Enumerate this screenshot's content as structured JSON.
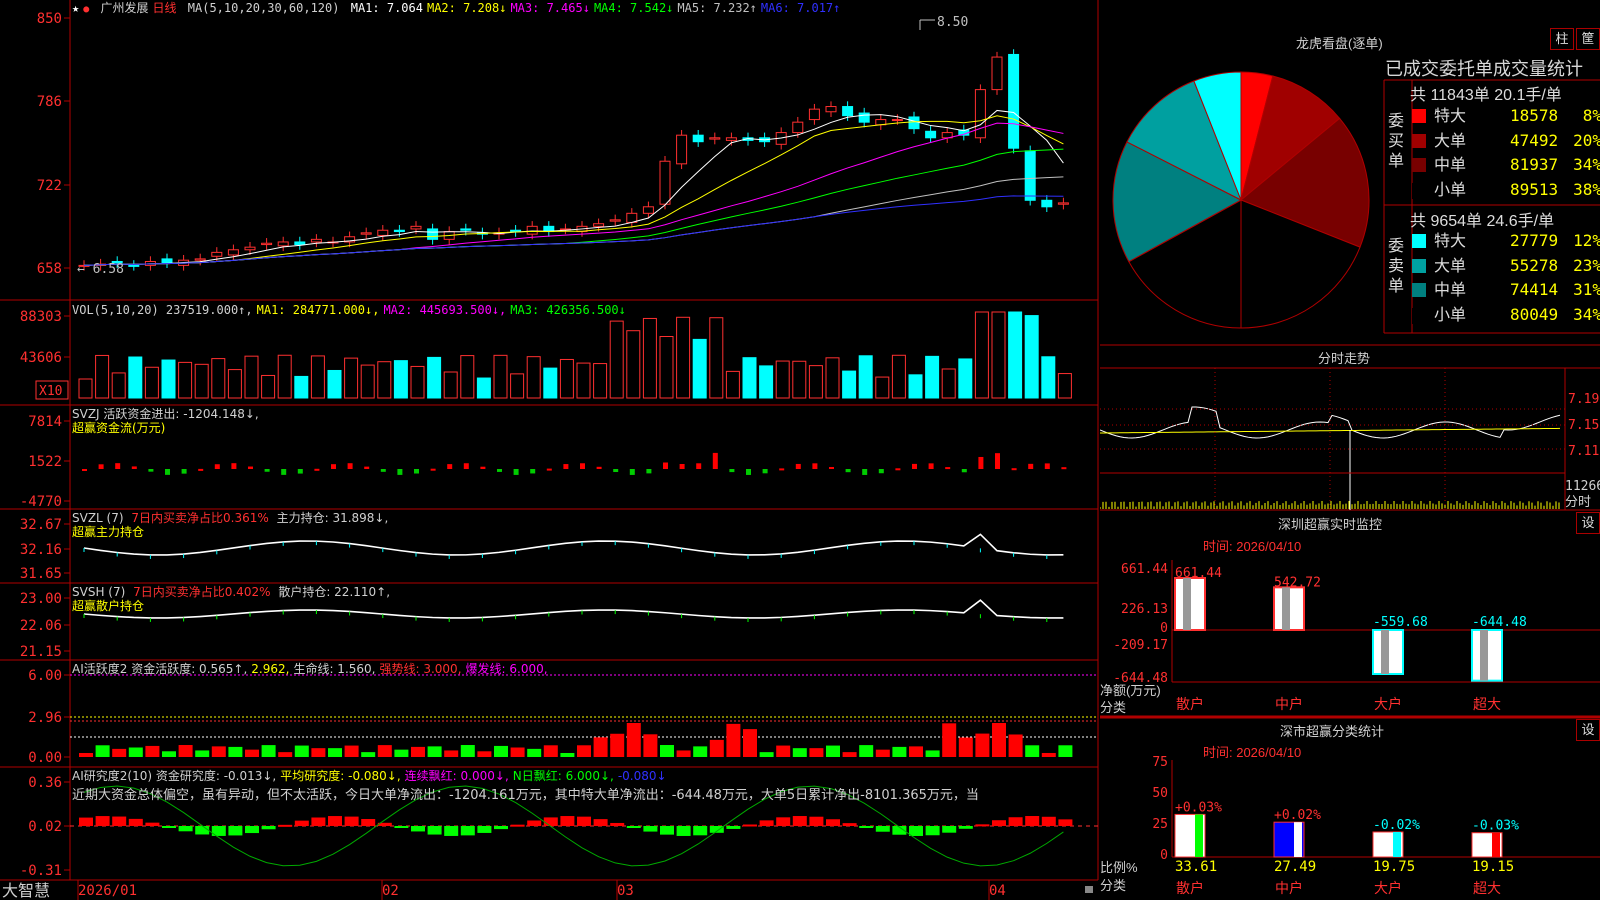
{
  "chart_header": {
    "star": "★",
    "stock_name": "广州发展",
    "period": "日线",
    "ma_label": "MA(5,10,20,30,60,120)",
    "ma": [
      {
        "label": "MA1: 7.064",
        "color": "#ffffff"
      },
      {
        "label": "MA2: 7.208↓",
        "color": "#ffff00"
      },
      {
        "label": "MA3: 7.465↓",
        "color": "#ff00ff"
      },
      {
        "label": "MA4: 7.542↓",
        "color": "#00ff00"
      },
      {
        "label": "MA5: 7.232↑",
        "color": "#c0c0c0"
      },
      {
        "label": "MA6: 7.017↑",
        "color": "#3030ff"
      }
    ],
    "high_label": "8.50",
    "low_label": "6.58"
  },
  "price_axis": [
    "850",
    "786",
    "722",
    "658"
  ],
  "vol_panel": {
    "header": [
      {
        "text": "VOL(5,10,20) 237519.000↑,",
        "color": "#d0d0d0"
      },
      {
        "text": "MA1: 284771.000↓,",
        "color": "#ffff00"
      },
      {
        "text": "MA2: 445693.500↓,",
        "color": "#ff00ff"
      },
      {
        "text": "MA3: 426356.500↓",
        "color": "#00ff00"
      }
    ],
    "axis": [
      "88303",
      "43606"
    ],
    "unit": "X10"
  },
  "svzj_panel": {
    "line1": "SVZJ  活跃资金进出: -1204.148↓,",
    "line2": "超赢资金流(万元)",
    "axis": [
      "7814",
      "1522",
      "-4770"
    ]
  },
  "svzl_panel": {
    "prefix": "SVZL (7) ",
    "red": "7日内买卖净占比0.361%",
    "rest": " 主力持仓: 31.898↓,",
    "line2": "超赢主力持仓",
    "axis": [
      "32.67",
      "32.16",
      "31.65"
    ]
  },
  "svsh_panel": {
    "prefix": "SVSH (7) ",
    "red": "7日内买卖净占比0.402%",
    "rest": " 散户持仓: 22.110↑,",
    "line2": "超赢散户持仓",
    "axis": [
      "23.00",
      "22.06",
      "21.15"
    ]
  },
  "ai_active_panel": {
    "header": [
      {
        "text": "AI活跃度2 资金活跃度: 0.565↑,",
        "color": "#d0d0d0"
      },
      {
        "text": "2.962,",
        "color": "#ffff00"
      },
      {
        "text": "生命线: 1.560,",
        "color": "#d0d0d0"
      },
      {
        "text": "强势线: 3.000,",
        "color": "#ff3030"
      },
      {
        "text": "爆发线: 6.000,",
        "color": "#ff00ff"
      }
    ],
    "axis": [
      "6.00",
      "2.96",
      "0.00"
    ]
  },
  "ai_research_panel": {
    "header": [
      {
        "text": "AI研究度2(10) 资金研究度: -0.013↓,",
        "color": "#d0d0d0"
      },
      {
        "text": "平均研究度: -0.080↓,",
        "color": "#ffff00"
      },
      {
        "text": "连续飘红: 0.000↓,",
        "color": "#ff00ff"
      },
      {
        "text": "N日飘红: 6.000↓,",
        "color": "#00ff00"
      },
      {
        "text": "-0.080↓",
        "color": "#3030ff"
      }
    ],
    "comment": "近期大资金总体偏空，虽有异动，但不太活跃，今日大单净流出：-1204.161万元，其中特大单净流出：-644.48万元，大单5日累计净出-8101.365万元，当",
    "axis": [
      "0.36",
      "0.02",
      "-0.31"
    ]
  },
  "date_axis": {
    "brand": "大智慧",
    "labels": [
      "2026/01",
      "02",
      "03",
      "04"
    ]
  },
  "dragon_tiger": {
    "title": "龙虎看盘(逐单)",
    "btn1": "柱",
    "btn2": "筐",
    "table_title": "已成交委托单成交量统计",
    "buy_side": "委买单",
    "sell_side": "委卖单",
    "buy_summary": "共 11843单 20.1手/单",
    "sell_summary": "共 9654单 24.6手/单",
    "buy_rows": [
      {
        "label": "特大",
        "value": "18578",
        "pct": "8%",
        "color": "#ff0000"
      },
      {
        "label": "大单",
        "value": "47492",
        "pct": "20%",
        "color": "#a00000"
      },
      {
        "label": "中单",
        "value": "81937",
        "pct": "34%",
        "color": "#780000"
      },
      {
        "label": "小单",
        "value": "89513",
        "pct": "38%",
        "color": "#000000"
      }
    ],
    "sell_rows": [
      {
        "label": "特大",
        "value": "27779",
        "pct": "12%",
        "color": "#00ffff"
      },
      {
        "label": "大单",
        "value": "55278",
        "pct": "23%",
        "color": "#00a0a0"
      },
      {
        "label": "中单",
        "value": "74414",
        "pct": "31%",
        "color": "#008080"
      },
      {
        "label": "小单",
        "value": "80049",
        "pct": "34%",
        "color": "#000000"
      }
    ]
  },
  "intraday": {
    "title": "分时走势",
    "axis": [
      "7.19",
      "7.15",
      "7.11",
      "11266",
      "分时"
    ]
  },
  "realtime_monitor": {
    "title": "深圳超赢实时监控",
    "btn": "设",
    "time": "时间: 2026/04/10",
    "axis": [
      "661.44",
      "226.13",
      "0",
      "-209.17",
      "-644.48"
    ],
    "ylabel": "净额(万元)",
    "xlabel": "分类",
    "bars": [
      {
        "cat": "散户",
        "value": 661.44,
        "label": "661.44"
      },
      {
        "cat": "中户",
        "value": 542.72,
        "label": "542.72"
      },
      {
        "cat": "大户",
        "value": -559.68,
        "label": "-559.68"
      },
      {
        "cat": "超大",
        "value": -644.48,
        "label": "-644.48"
      }
    ]
  },
  "classify_stats": {
    "title": "深市超赢分类统计",
    "btn": "设",
    "time": "时间: 2026/04/10",
    "axis": [
      "75",
      "50",
      "25",
      "0"
    ],
    "ylabel": "比例%",
    "xlabel": "分类",
    "bars": [
      {
        "cat": "散户",
        "value": 33.61,
        "label": "33.61",
        "delta": "+0.03%"
      },
      {
        "cat": "中户",
        "value": 27.49,
        "label": "27.49",
        "delta": "+0.02%"
      },
      {
        "cat": "大户",
        "value": 19.75,
        "label": "19.75",
        "delta": "-0.02%"
      },
      {
        "cat": "超大",
        "value": 19.15,
        "label": "19.15",
        "delta": "-0.03%"
      }
    ]
  }
}
